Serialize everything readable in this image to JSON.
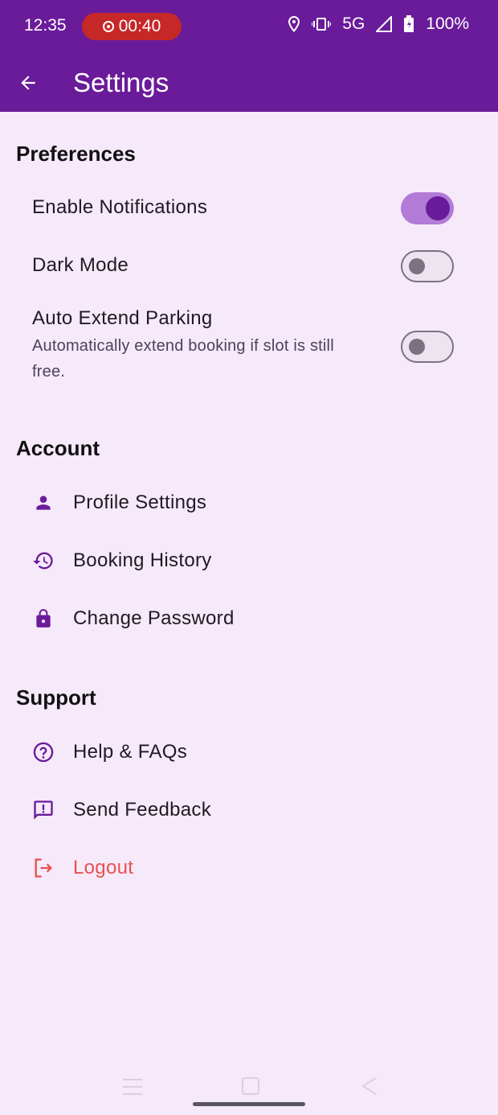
{
  "status_bar": {
    "time": "12:35",
    "recording_timer": "00:40",
    "network": "5G",
    "battery": "100%"
  },
  "app_bar": {
    "title": "Settings",
    "background_color": "#6a1b9a"
  },
  "sections": {
    "preferences": {
      "title": "Preferences",
      "items": [
        {
          "label": "Enable Notifications",
          "subtitle": "",
          "enabled": true
        },
        {
          "label": "Dark Mode",
          "subtitle": "",
          "enabled": false
        },
        {
          "label": "Auto Extend Parking",
          "subtitle": "Automatically extend booking if slot is still free.",
          "enabled": false
        }
      ]
    },
    "account": {
      "title": "Account",
      "items": [
        {
          "label": "Profile Settings",
          "icon": "person-icon"
        },
        {
          "label": "Booking History",
          "icon": "history-icon"
        },
        {
          "label": "Change Password",
          "icon": "lock-icon"
        }
      ]
    },
    "support": {
      "title": "Support",
      "items": [
        {
          "label": "Help & FAQs",
          "icon": "help-icon"
        },
        {
          "label": "Send Feedback",
          "icon": "feedback-icon"
        },
        {
          "label": "Logout",
          "icon": "logout-icon",
          "color": "#e85050"
        }
      ]
    }
  },
  "colors": {
    "accent": "#6a1b9a",
    "background": "#f6e9fa",
    "danger": "#e85050"
  }
}
